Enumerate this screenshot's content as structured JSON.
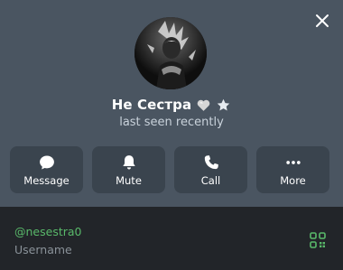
{
  "profile": {
    "name": "Не Сестра",
    "status": "last seen recently",
    "badges": [
      "heart-emoji",
      "star-icon"
    ]
  },
  "actions": [
    {
      "label": "Message",
      "icon": "message-icon"
    },
    {
      "label": "Mute",
      "icon": "bell-icon"
    },
    {
      "label": "Call",
      "icon": "phone-icon"
    },
    {
      "label": "More",
      "icon": "more-dots-icon"
    }
  ],
  "info": {
    "username": "@nesestra0",
    "username_caption": "Username"
  },
  "colors": {
    "header_bg": "#4a5561",
    "button_bg": "#3a444e",
    "info_bg": "#222529",
    "link_green": "#59b96a"
  }
}
